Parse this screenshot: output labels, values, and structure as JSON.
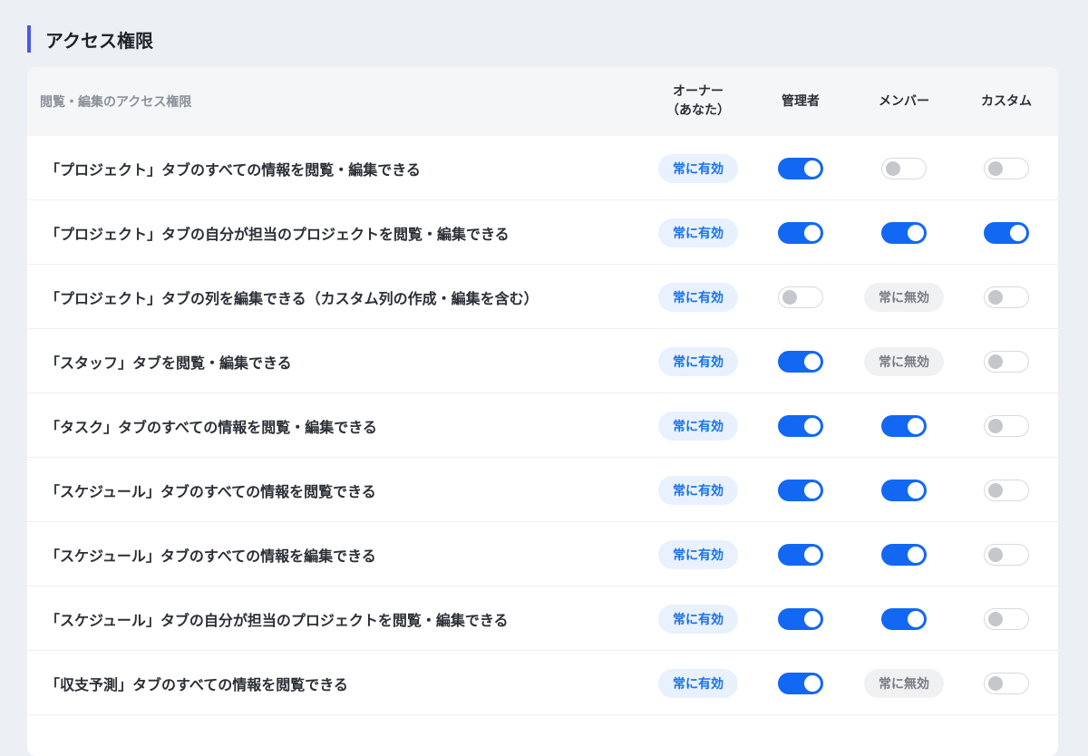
{
  "section_title": "アクセス権限",
  "table": {
    "header_label": "閲覧・編集のアクセス権限",
    "columns": {
      "owner_line1": "オーナー",
      "owner_line2": "（あなた）",
      "admin": "管理者",
      "member": "メンバー",
      "custom": "カスタム"
    },
    "badges": {
      "always_on": "常に有効",
      "always_off": "常に無効"
    },
    "rows": [
      {
        "label": "「プロジェクト」タブのすべての情報を閲覧・編集できる",
        "owner": "always_on",
        "admin": "on",
        "member": "off",
        "custom": "off"
      },
      {
        "label": "「プロジェクト」タブの自分が担当のプロジェクトを閲覧・編集できる",
        "owner": "always_on",
        "admin": "on",
        "member": "on",
        "custom": "on"
      },
      {
        "label": "「プロジェクト」タブの列を編集できる（カスタム列の作成・編集を含む）",
        "owner": "always_on",
        "admin": "off",
        "member": "always_off",
        "custom": "off"
      },
      {
        "label": "「スタッフ」タブを閲覧・編集できる",
        "owner": "always_on",
        "admin": "on",
        "member": "always_off",
        "custom": "off"
      },
      {
        "label": "「タスク」タブのすべての情報を閲覧・編集できる",
        "owner": "always_on",
        "admin": "on",
        "member": "on",
        "custom": "off"
      },
      {
        "label": "「スケジュール」タブのすべての情報を閲覧できる",
        "owner": "always_on",
        "admin": "on",
        "member": "on",
        "custom": "off"
      },
      {
        "label": "「スケジュール」タブのすべての情報を編集できる",
        "owner": "always_on",
        "admin": "on",
        "member": "on",
        "custom": "off"
      },
      {
        "label": "「スケジュール」タブの自分が担当のプロジェクトを閲覧・編集できる",
        "owner": "always_on",
        "admin": "on",
        "member": "on",
        "custom": "off"
      },
      {
        "label": "「収支予測」タブのすべての情報を閲覧できる",
        "owner": "always_on",
        "admin": "on",
        "member": "always_off",
        "custom": "off"
      }
    ]
  }
}
